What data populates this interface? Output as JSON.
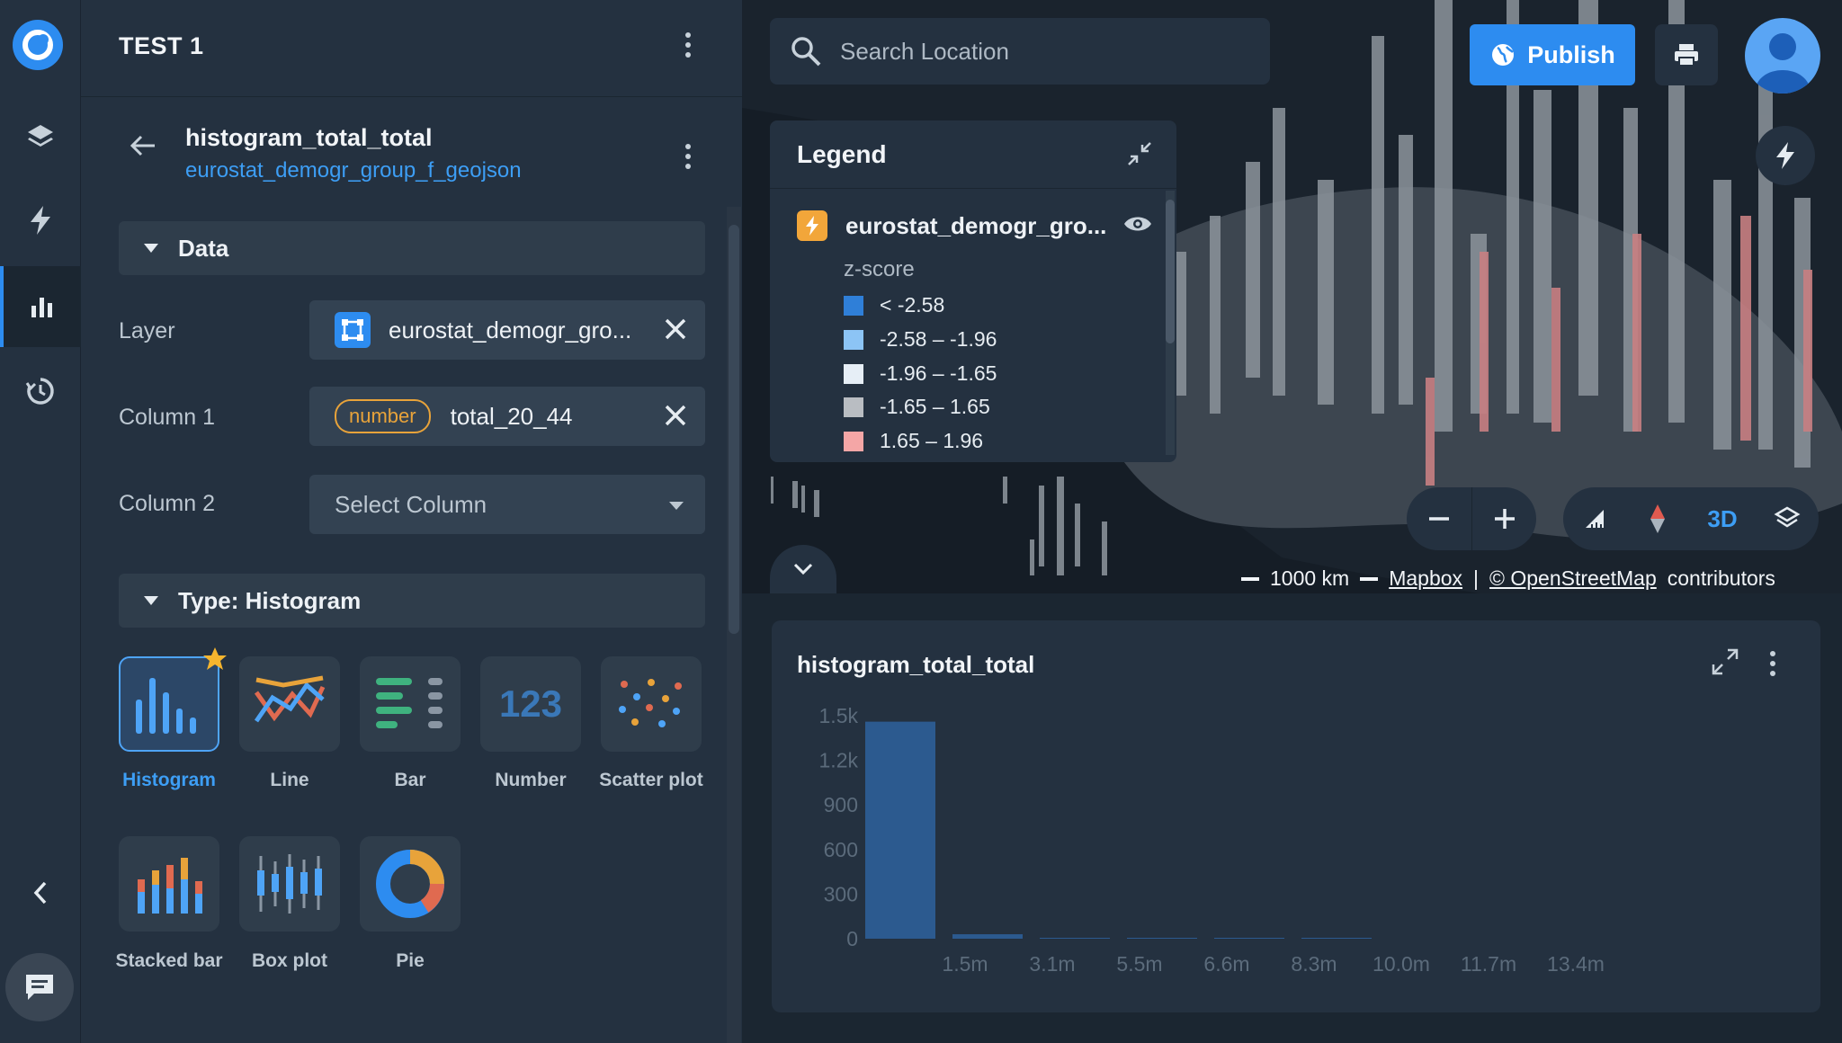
{
  "project": {
    "title": "TEST 1"
  },
  "widget": {
    "title": "histogram_total_total",
    "dataset": "eurostat_demogr_group_f_geojson"
  },
  "data_section": {
    "header": "Data",
    "layer_label": "Layer",
    "layer_value": "eurostat_demogr_gro...",
    "column1_label": "Column 1",
    "column1_type": "number",
    "column1_value": "total_20_44",
    "column2_label": "Column 2",
    "column2_placeholder": "Select Column"
  },
  "type_section": {
    "header": "Type: Histogram",
    "types": [
      {
        "label": "Histogram",
        "selected": true
      },
      {
        "label": "Line"
      },
      {
        "label": "Bar"
      },
      {
        "label": "Number",
        "glyph": "123"
      },
      {
        "label": "Scatter plot"
      },
      {
        "label": "Stacked bar"
      },
      {
        "label": "Box plot"
      },
      {
        "label": "Pie"
      }
    ]
  },
  "search": {
    "placeholder": "Search Location"
  },
  "toolbar": {
    "publish_label": "Publish"
  },
  "legend": {
    "title": "Legend",
    "layer_name": "eurostat_demogr_gro...",
    "metric": "z-score",
    "items": [
      {
        "label": "< -2.58",
        "color": "#2f7fd8"
      },
      {
        "label": "-2.58 – -1.96",
        "color": "#8cc4f5"
      },
      {
        "label": "-1.96 – -1.65",
        "color": "#e6eef6"
      },
      {
        "label": "-1.65 – 1.65",
        "color": "#b9bdc2"
      },
      {
        "label": "1.65 – 1.96",
        "color": "#f4a6a6"
      }
    ]
  },
  "map_controls": {
    "mode_3d": "3D"
  },
  "attribution": {
    "scale": "1000 km",
    "mapbox": "Mapbox",
    "separator": "|",
    "osm": "© OpenStreetMap",
    "suffix": "contributors"
  },
  "chart_data": {
    "type": "bar",
    "title": "histogram_total_total",
    "xlabel": "",
    "ylabel": "",
    "x_tick_labels": [
      "1.5m",
      "3.1m",
      "5.5m",
      "6.6m",
      "8.3m",
      "10.0m",
      "11.7m",
      "13.4m"
    ],
    "y_tick_labels": [
      "1.5k",
      "1.2k",
      "900",
      "600",
      "300",
      "0"
    ],
    "y_ticks": [
      1500,
      1200,
      900,
      600,
      300,
      0
    ],
    "ylim": [
      0,
      1500
    ],
    "values": [
      1460,
      30,
      6,
      2,
      1,
      1,
      0,
      0,
      0,
      0
    ],
    "colors": {
      "bar": "#2c5a8f",
      "axis_text": "#5b6b7b"
    }
  }
}
